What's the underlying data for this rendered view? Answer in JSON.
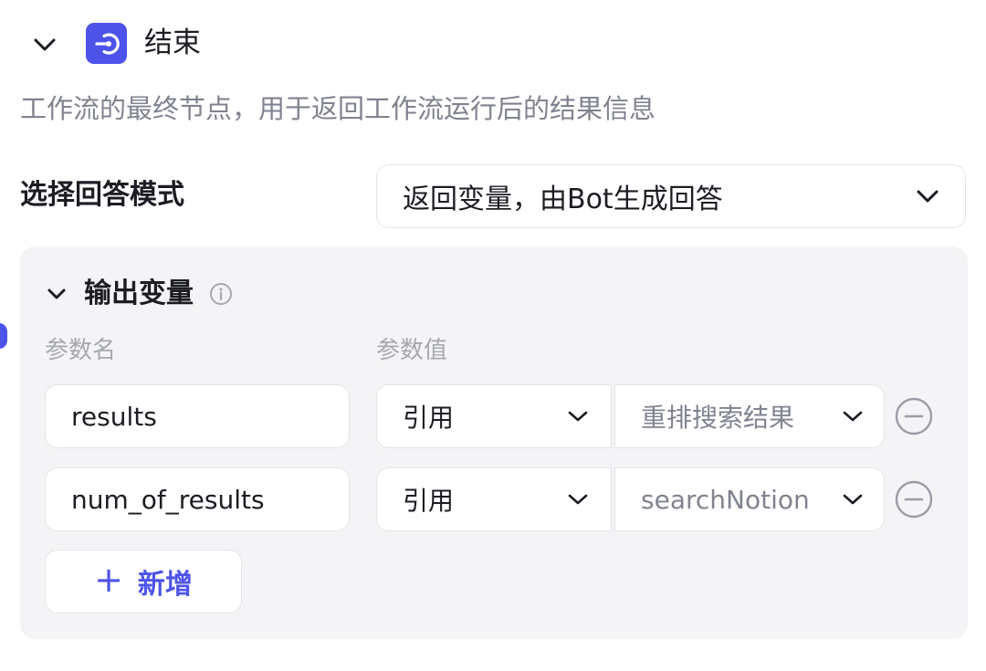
{
  "node": {
    "title": "结束",
    "description": "工作流的最终节点，用于返回工作流运行后的结果信息",
    "accent_color": "#4d53e8"
  },
  "answer_mode": {
    "label": "选择回答模式",
    "selected": "返回变量，由Bot生成回答"
  },
  "output": {
    "title": "输出变量",
    "columns": [
      "参数名",
      "参数值"
    ],
    "rows": [
      {
        "name": "results",
        "type": "引用",
        "ref": "重排搜索结果"
      },
      {
        "name": "num_of_results",
        "type": "引用",
        "ref": "searchNotion"
      }
    ],
    "add_label": "新增"
  },
  "icons": {
    "collapse": "chevron-down-icon",
    "node": "end-node-icon",
    "info": "info-icon",
    "remove": "minus-circle-icon",
    "add": "plus-icon"
  }
}
